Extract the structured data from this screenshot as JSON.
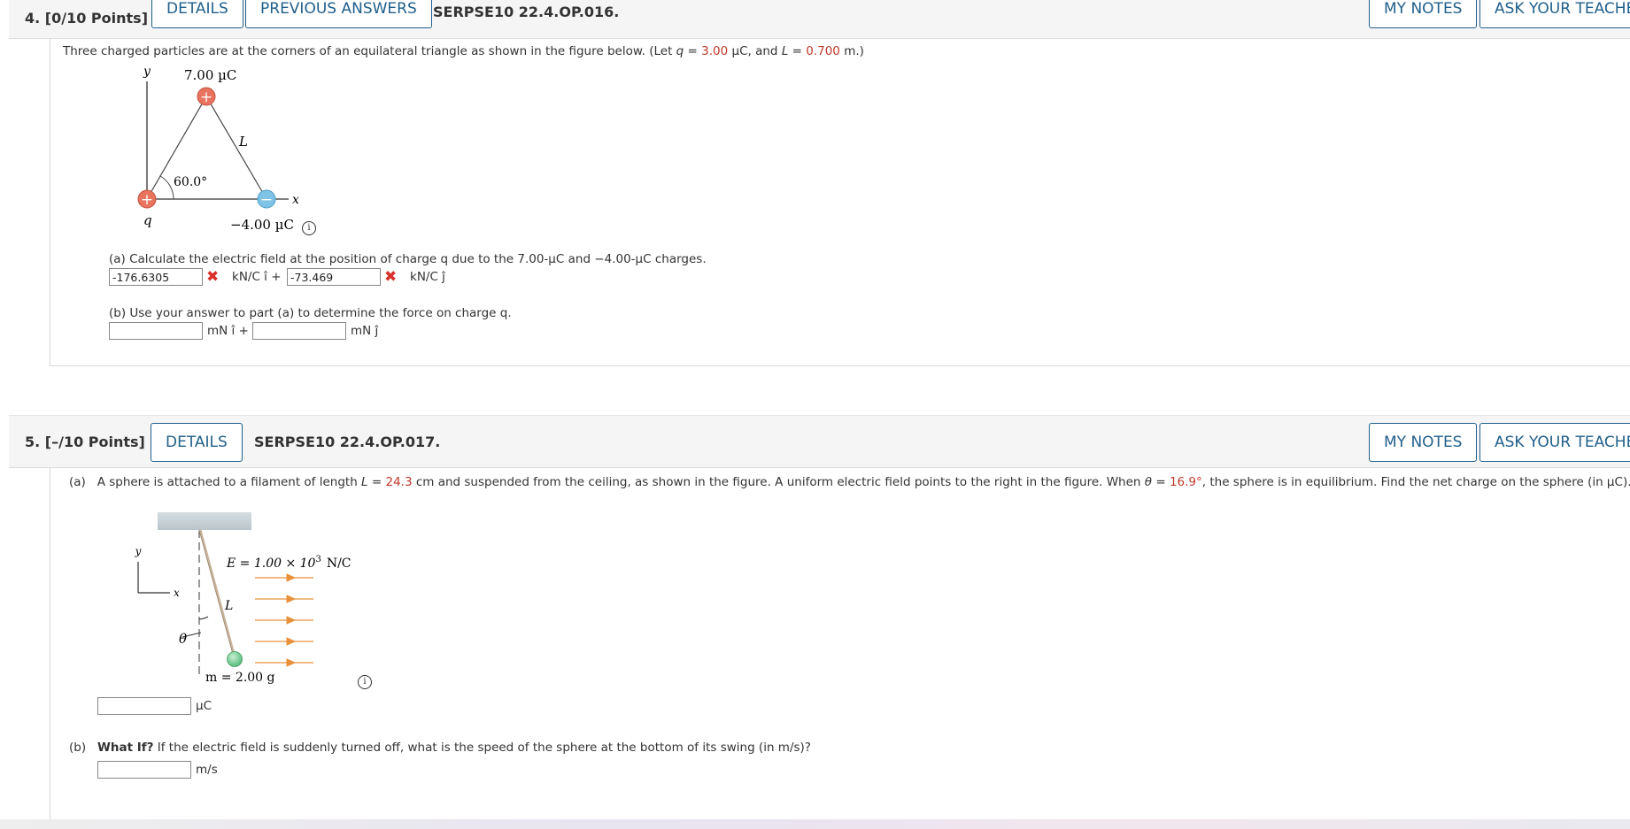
{
  "q4": {
    "number": "4.",
    "points": "[0/10 Points]",
    "details_label": "DETAILS",
    "previous_answers_label": "PREVIOUS ANSWERS",
    "code": "SERPSE10 22.4.OP.016.",
    "my_notes_label": "MY NOTES",
    "ask_teacher_label": "ASK YOUR TEACHER",
    "intro_prefix": "Three charged particles are at the corners of an equilateral triangle as shown in the figure below. (Let ",
    "intro_q_var": "q",
    "intro_eq1": " = ",
    "q_value": "3.00",
    "intro_mid": " µC, and ",
    "intro_L_var": "L",
    "intro_eq2": " = ",
    "L_value": "0.700",
    "intro_suffix": " m.)",
    "figure": {
      "top_charge": "7.00 µC",
      "bottom_left_charge": "q",
      "bottom_right_charge": "−4.00 µC",
      "angle": "60.0°",
      "side_label": "L",
      "x_label": "x",
      "y_label": "y",
      "plus": "+",
      "minus": "−",
      "info_icon": "i"
    },
    "part_a": {
      "text": "(a) Calculate the electric field at the position of charge q due to the 7.00-µC and −4.00-µC charges.",
      "value_i": "-176.6305",
      "unit_i": "kN/C î +",
      "value_j": "-73.469",
      "unit_j": "kN/C ĵ",
      "wrong_mark": "✖"
    },
    "part_b": {
      "text": "(b) Use your answer to part (a) to determine the force on charge q.",
      "value_i": "",
      "unit_i": "mN î +",
      "value_j": "",
      "unit_j": "mN ĵ"
    }
  },
  "q5": {
    "number": "5.",
    "points": "[–/10 Points]",
    "details_label": "DETAILS",
    "code": "SERPSE10 22.4.OP.017.",
    "my_notes_label": "MY NOTES",
    "ask_teacher_label": "ASK YOUR TEACHER",
    "part_a_label": "(a)",
    "part_a_prefix": "A sphere is attached to a filament of length ",
    "part_a_L_var": "L",
    "part_a_eq1": " = ",
    "L_value": "24.3",
    "part_a_mid": " cm and suspended from the ceiling, as shown in the figure. A uniform electric field points to the right in the figure. When ",
    "part_a_theta_var": "θ",
    "part_a_eq2": " = ",
    "theta_value": "16.9°",
    "part_a_suffix": ", the sphere is in equilibrium. Find the net charge on the sphere (in µC).",
    "figure": {
      "field_label_prefix": "E = 1.00 × 10",
      "field_label_exp": "3",
      "field_label_unit": "N/C",
      "mass_label": "m = 2.00 g",
      "length_label": "L",
      "theta_label": "θ",
      "x_label": "x",
      "y_label": "y",
      "info_icon": "i"
    },
    "part_a_value": "",
    "part_a_unit": "µC",
    "part_b_label": "(b)",
    "part_b_bold": "What If?",
    "part_b_text": " If the electric field is suddenly turned off, what is the speed of the sphere at the bottom of its swing (in m/s)?",
    "part_b_value": "",
    "part_b_unit": "m/s"
  }
}
